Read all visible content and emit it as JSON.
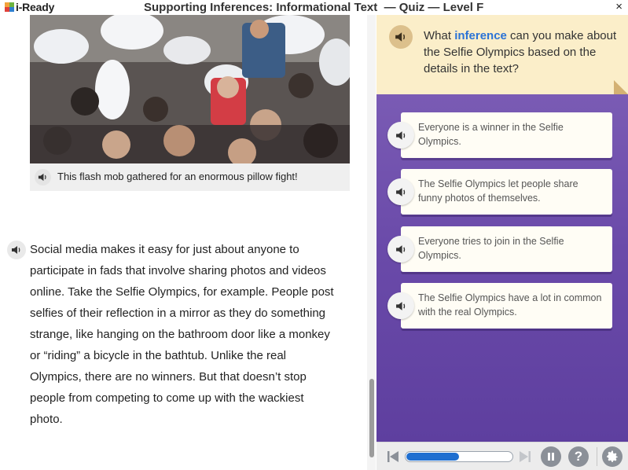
{
  "app": {
    "logo_text": "i-Ready",
    "title": "Supporting Inferences: Informational Text  — Quiz — Level F",
    "close_label": "×"
  },
  "passage": {
    "image_alt": "flash mob pillow fight photo",
    "caption": "This flash mob gathered for an enormous pillow fight!",
    "lines": [
      "Social media makes it easy for just about anyone to",
      "participate in fads that involve sharing photos and videos",
      "online. Take the Selfie Olympics, for example. People post",
      "selfies of their reflection in a mirror as they do something",
      "strange, like hanging on the bathroom door like a monkey",
      "or “riding” a bicycle in the bathtub. Unlike the real",
      "Olympics, there are no winners. But that doesn’t stop",
      "people from competing to come up with the wackiest",
      "photo."
    ]
  },
  "question": {
    "before": "What ",
    "highlight": "inference",
    "after": " can you make about the Selfie Olympics based on the details in the text?"
  },
  "answers": [
    {
      "text": "Everyone is a winner in the Selfie Olympics."
    },
    {
      "text": "The Selfie Olympics let people share funny photos of themselves."
    },
    {
      "text": "Everyone tries to join in the Selfie Olympics."
    },
    {
      "text": "The Selfie Olympics have a lot in common with the real Olympics."
    }
  ],
  "controls": {
    "progress_fraction": 0.5,
    "help_label": "?"
  },
  "colors": {
    "accent": "#2b73d6",
    "question_bg": "#fbeec9",
    "answer_panel": "#6a4aa9",
    "progress": "#1f6fd0"
  },
  "icons": [
    "speaker-icon",
    "back-icon",
    "next-icon",
    "pause-icon",
    "help-icon",
    "gear-icon",
    "close-icon"
  ]
}
